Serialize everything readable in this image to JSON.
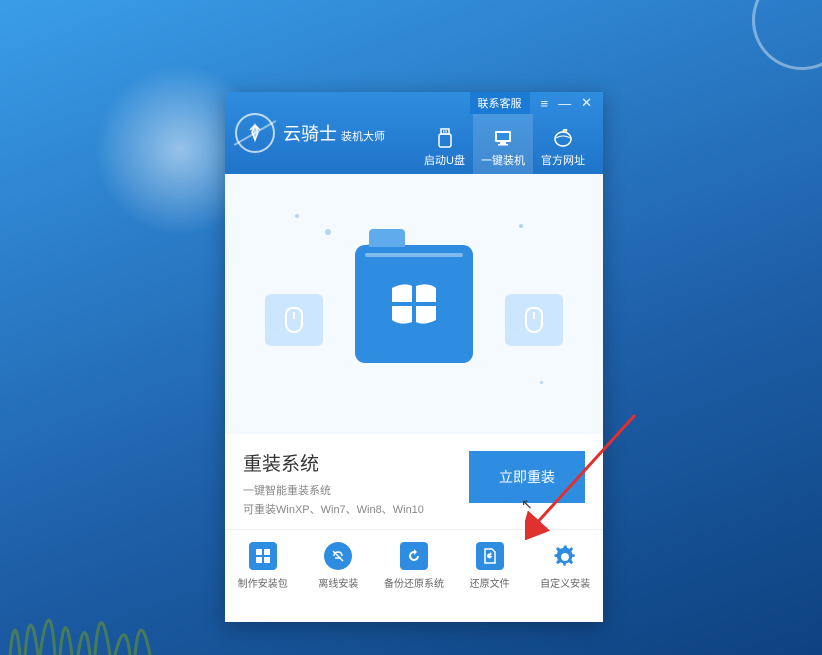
{
  "header": {
    "app_name": "云骑士",
    "app_subtitle": "装机大师",
    "contact_label": "联系客服",
    "tabs": [
      {
        "label": "启动U盘",
        "icon": "usb"
      },
      {
        "label": "一键装机",
        "icon": "monitor"
      },
      {
        "label": "官方网址",
        "icon": "globe"
      }
    ]
  },
  "main": {
    "title": "重装系统",
    "subtitle1": "一键智能重装系统",
    "subtitle2": "可重装WinXP、Win7、Win8、Win10",
    "primary_button": "立即重装"
  },
  "tools": [
    {
      "label": "制作安装包"
    },
    {
      "label": "离线安装"
    },
    {
      "label": "备份还原系统"
    },
    {
      "label": "还原文件"
    },
    {
      "label": "自定义安装"
    }
  ]
}
